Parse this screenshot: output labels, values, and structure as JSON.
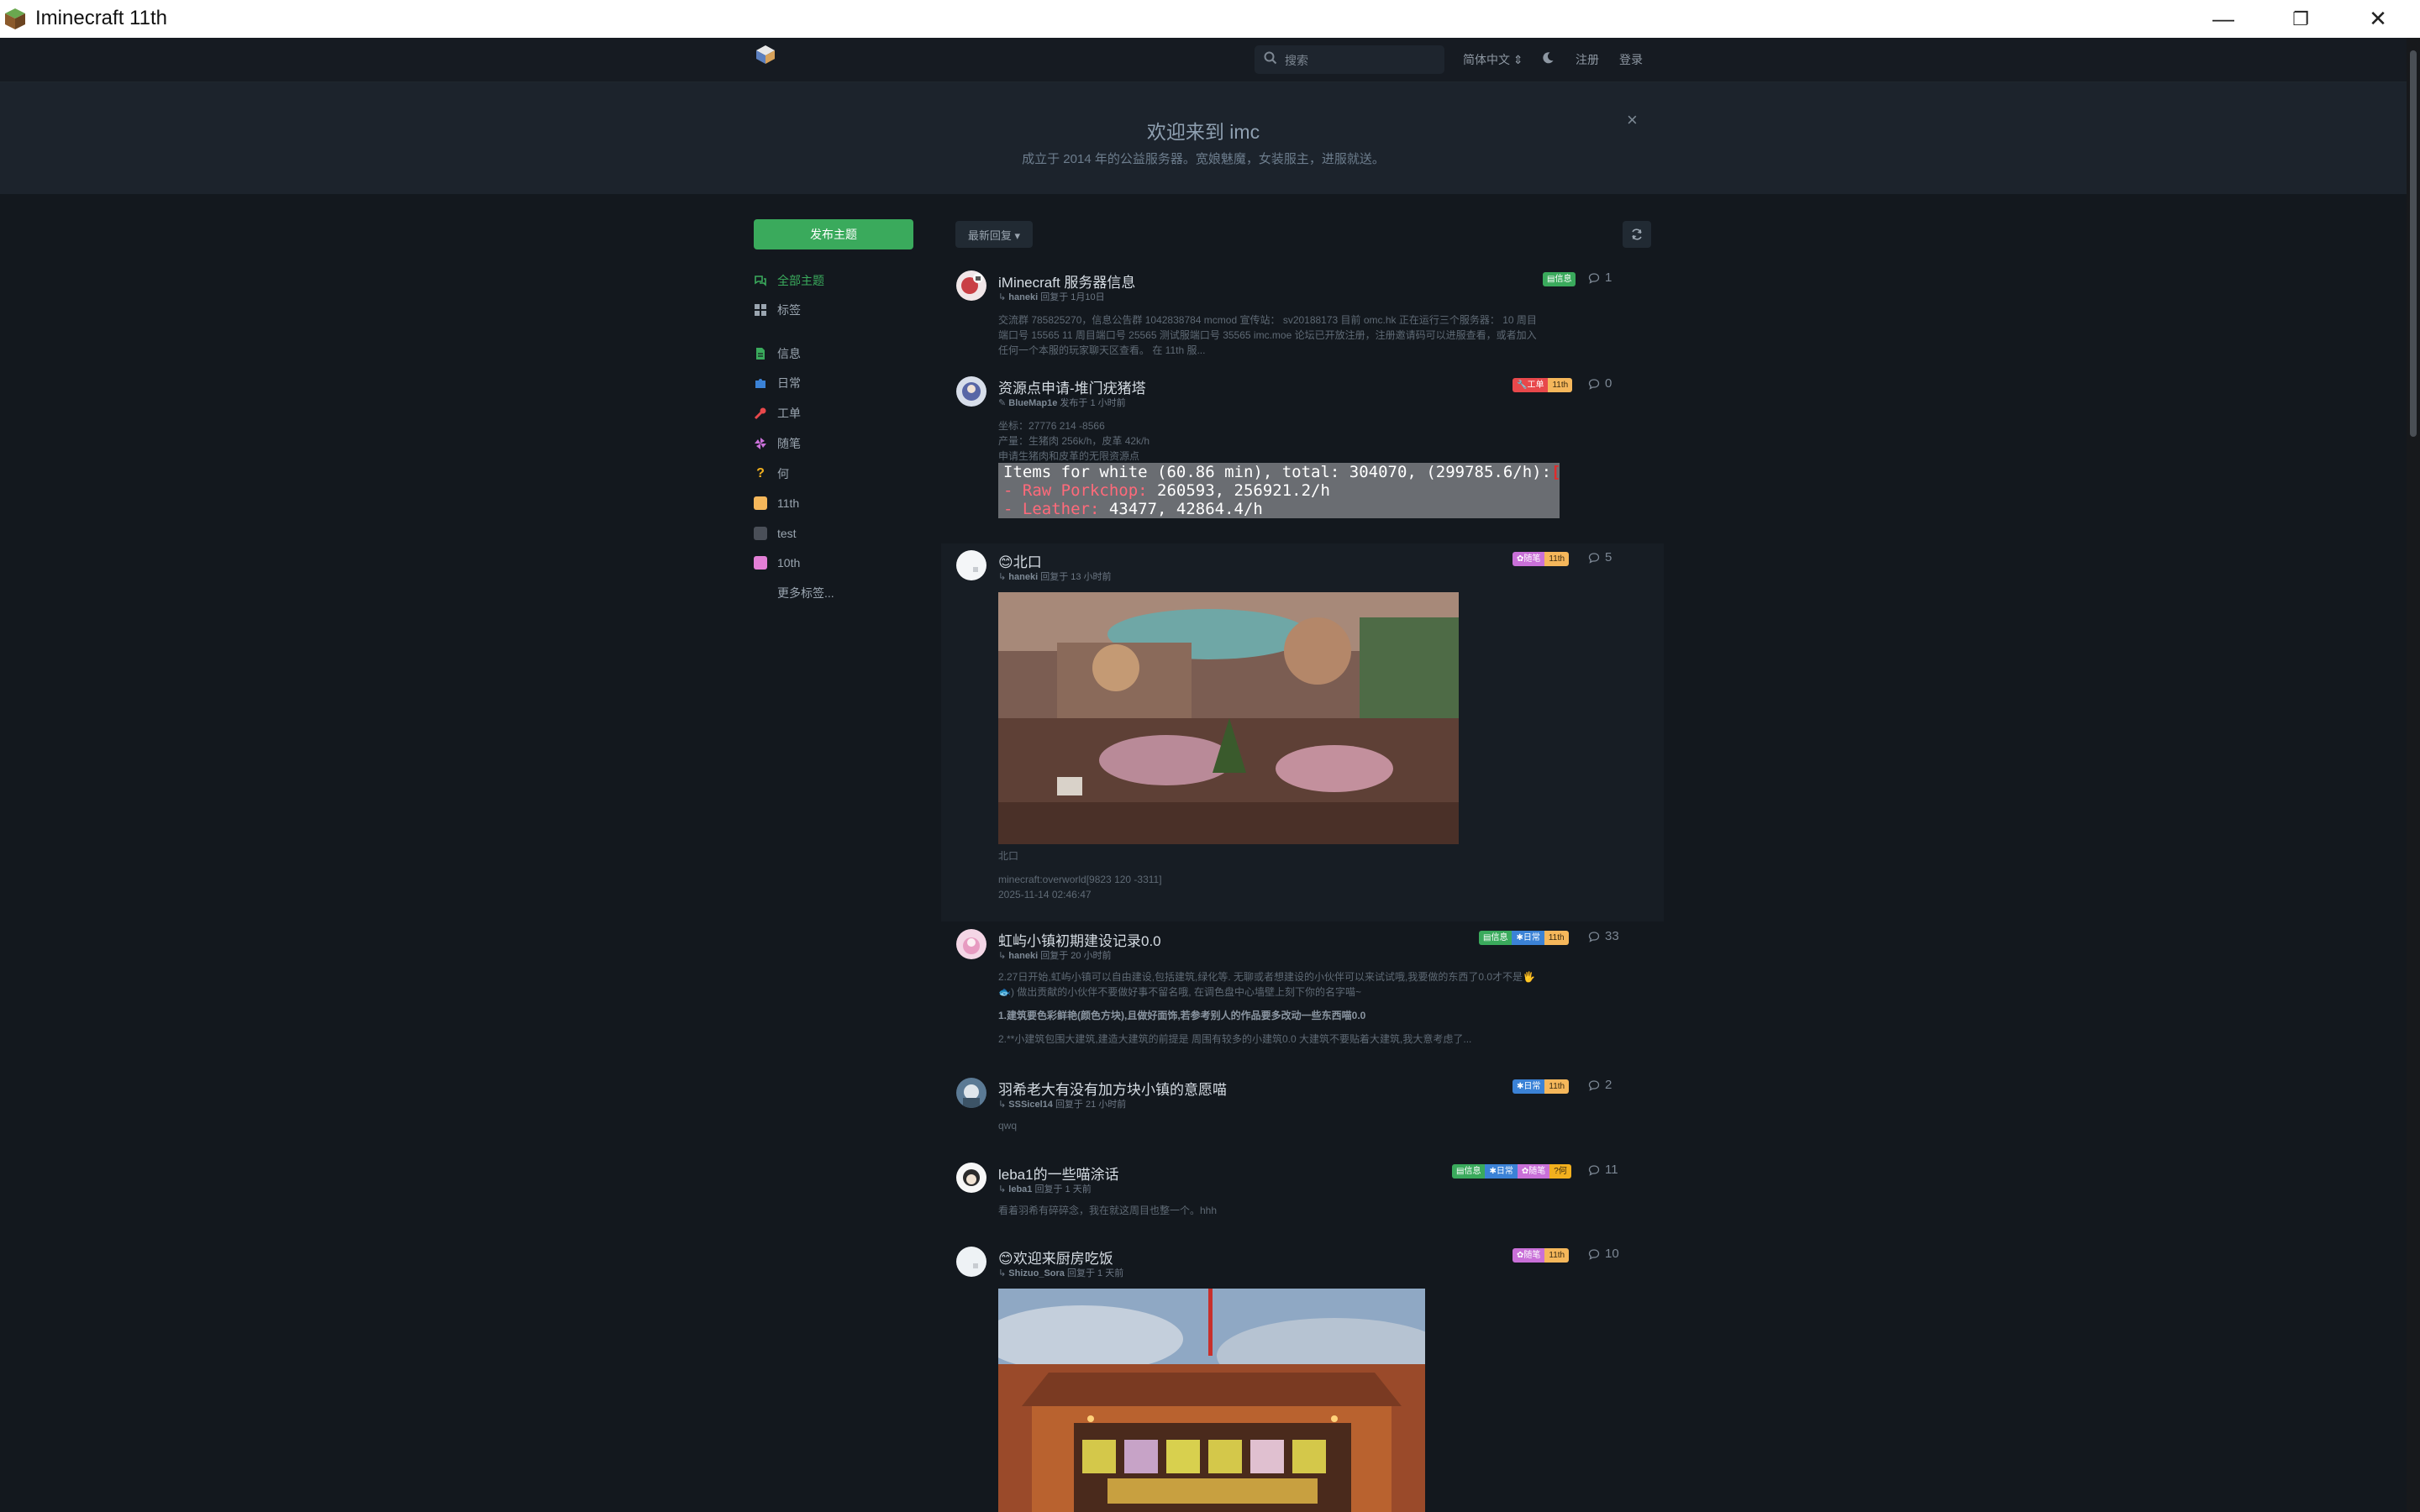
{
  "window": {
    "title": "Iminecraft 11th",
    "minimize": "—",
    "maximize": "❐",
    "close": "✕"
  },
  "header": {
    "search_placeholder": "搜索",
    "language": "简体中文 ⇕",
    "register": "注册",
    "login": "登录"
  },
  "hero": {
    "title": "欢迎来到 imc",
    "subtitle": "成立于 2014 年的公益服务器。宽娘魅魔，女装服主，进服就送。",
    "close": "×"
  },
  "sidebar": {
    "new_topic": "发布主题",
    "nav": [
      {
        "label": "全部主题",
        "icon": "comments-icon",
        "color": "#3aaa5c"
      },
      {
        "label": "标签",
        "icon": "tags-grid-icon",
        "color": "#9aa5b0"
      }
    ],
    "tags": [
      {
        "label": "信息",
        "icon": "file-icon",
        "color": "#3aaa5c"
      },
      {
        "label": "日常",
        "icon": "puzzle-icon",
        "color": "#3b82d6"
      },
      {
        "label": "工单",
        "icon": "wrench-icon",
        "color": "#e8484b"
      },
      {
        "label": "随笔",
        "icon": "pinwheel-icon",
        "color": "#c970d8"
      },
      {
        "label": "何",
        "icon": "question-icon",
        "color": "#f2b01e"
      },
      {
        "label": "11th",
        "icon": "square",
        "color": "#f5b75b"
      },
      {
        "label": "test",
        "icon": "square",
        "color": "#4a4f58"
      },
      {
        "label": "10th",
        "icon": "square",
        "color": "#e37fd6"
      }
    ],
    "more_tags": "更多标签..."
  },
  "toolbar": {
    "sort": "最新回复 ▾"
  },
  "discussions": [
    {
      "title": "iMinecraft 服务器信息",
      "user": "haneki",
      "action": "回复于 1月10日",
      "excerpt": [
        "交流群 785825270，信息公告群 1042838784 mcmod 宣传站： sv20188173 目前 omc.hk 正在运行三个服务器：  10 周目",
        "端口号 15565 11 周目端口号 25565 测试服端口号 35565 imc.moe 论坛已开放注册，注册邀请码可以进服查看，或者加入",
        "任何一个本服的玩家聊天区查看。 在 11th 服..."
      ],
      "tags": [
        {
          "label": "▤信息",
          "color": "#3aaa5c"
        }
      ],
      "replies": "1"
    },
    {
      "title": "资源点申请-堆门疣猪塔",
      "user": "BlueMap1e",
      "action": "发布于 1 小时前",
      "excerpt": [
        "坐标：27776 214 -8566",
        "产量：生猪肉 256k/h，皮革 42k/h",
        "申请生猪肉和皮革的无限资源点"
      ],
      "tags": [
        {
          "label": "🔧工单",
          "color": "#e8484b"
        },
        {
          "label": "11th",
          "color": "#f5b75b"
        }
      ],
      "replies": "0",
      "panel": {
        "line1": "Items for white (60.86 min), total: 304070, (299785.6/h):",
        "line1_x": "[X]",
        "line2_name": " - Raw Porkchop:",
        "line2_val": " 260593, 256921.2/h",
        "line3_name": " - Leather:",
        "line3_val": " 43477, 42864.4/h"
      }
    },
    {
      "title": "😊北口",
      "user": "haneki",
      "action": "回复于 13 小时前",
      "caption": "北口",
      "location": "minecraft:overworld[9823 120 -3311]",
      "datetime": "2025-11-14 02:46:47",
      "tags": [
        {
          "label": "✿随笔",
          "color": "#c970d8"
        },
        {
          "label": "11th",
          "color": "#f5b75b"
        }
      ],
      "replies": "5"
    },
    {
      "title": "虹屿小镇初期建设记录0.0",
      "user": "haneki",
      "action": "回复于 20 小时前",
      "excerpt": [
        "2.27日开始,虹屿小镇可以自由建设,包括建筑,绿化等. 无聊或者想建设的小伙伴可以来试试哦,我要做的东西了0.0才不是🖐",
        "🐟) 做出贡献的小伙伴不要做好事不留名哦, 在调色盘中心墙壁上刻下你的名字喵~",
        "1.建筑要色彩鲜艳(颜色方块),且做好面饰,若参考别人的作品要多改动一些东西喵0.0",
        "2.**小建筑包围大建筑,建造大建筑的前提是 周围有较多的小建筑0.0 大建筑不要贴着大建筑,我大意考虑了..."
      ],
      "tags": [
        {
          "label": "▤信息",
          "color": "#3aaa5c"
        },
        {
          "label": "✱日常",
          "color": "#3b82d6"
        },
        {
          "label": "11th",
          "color": "#f5b75b"
        }
      ],
      "replies": "33"
    },
    {
      "title": "羽希老大有没有加方块小镇的意愿喵",
      "user": "SSSicel14",
      "action": "回复于 21 小时前",
      "excerpt": [
        "qwq"
      ],
      "tags": [
        {
          "label": "✱日常",
          "color": "#3b82d6"
        },
        {
          "label": "11th",
          "color": "#f5b75b"
        }
      ],
      "replies": "2"
    },
    {
      "title": "leba1的一些喵涂话",
      "user": "leba1",
      "action": "回复于 1 天前",
      "excerpt": [
        "看着羽希有碎碎念，我在就这周目也整一个。hhh"
      ],
      "tags": [
        {
          "label": "▤信息",
          "color": "#3aaa5c"
        },
        {
          "label": "✱日常",
          "color": "#3b82d6"
        },
        {
          "label": "✿随笔",
          "color": "#c970d8"
        },
        {
          "label": "?何",
          "color": "#f2b01e"
        }
      ],
      "replies": "11"
    },
    {
      "title": "😊欢迎来厨房吃饭",
      "user": "Shizuo_Sora",
      "action": "回复于 1 天前",
      "tags": [
        {
          "label": "✿随笔",
          "color": "#c970d8"
        },
        {
          "label": "11th",
          "color": "#f5b75b"
        }
      ],
      "replies": "10"
    }
  ]
}
